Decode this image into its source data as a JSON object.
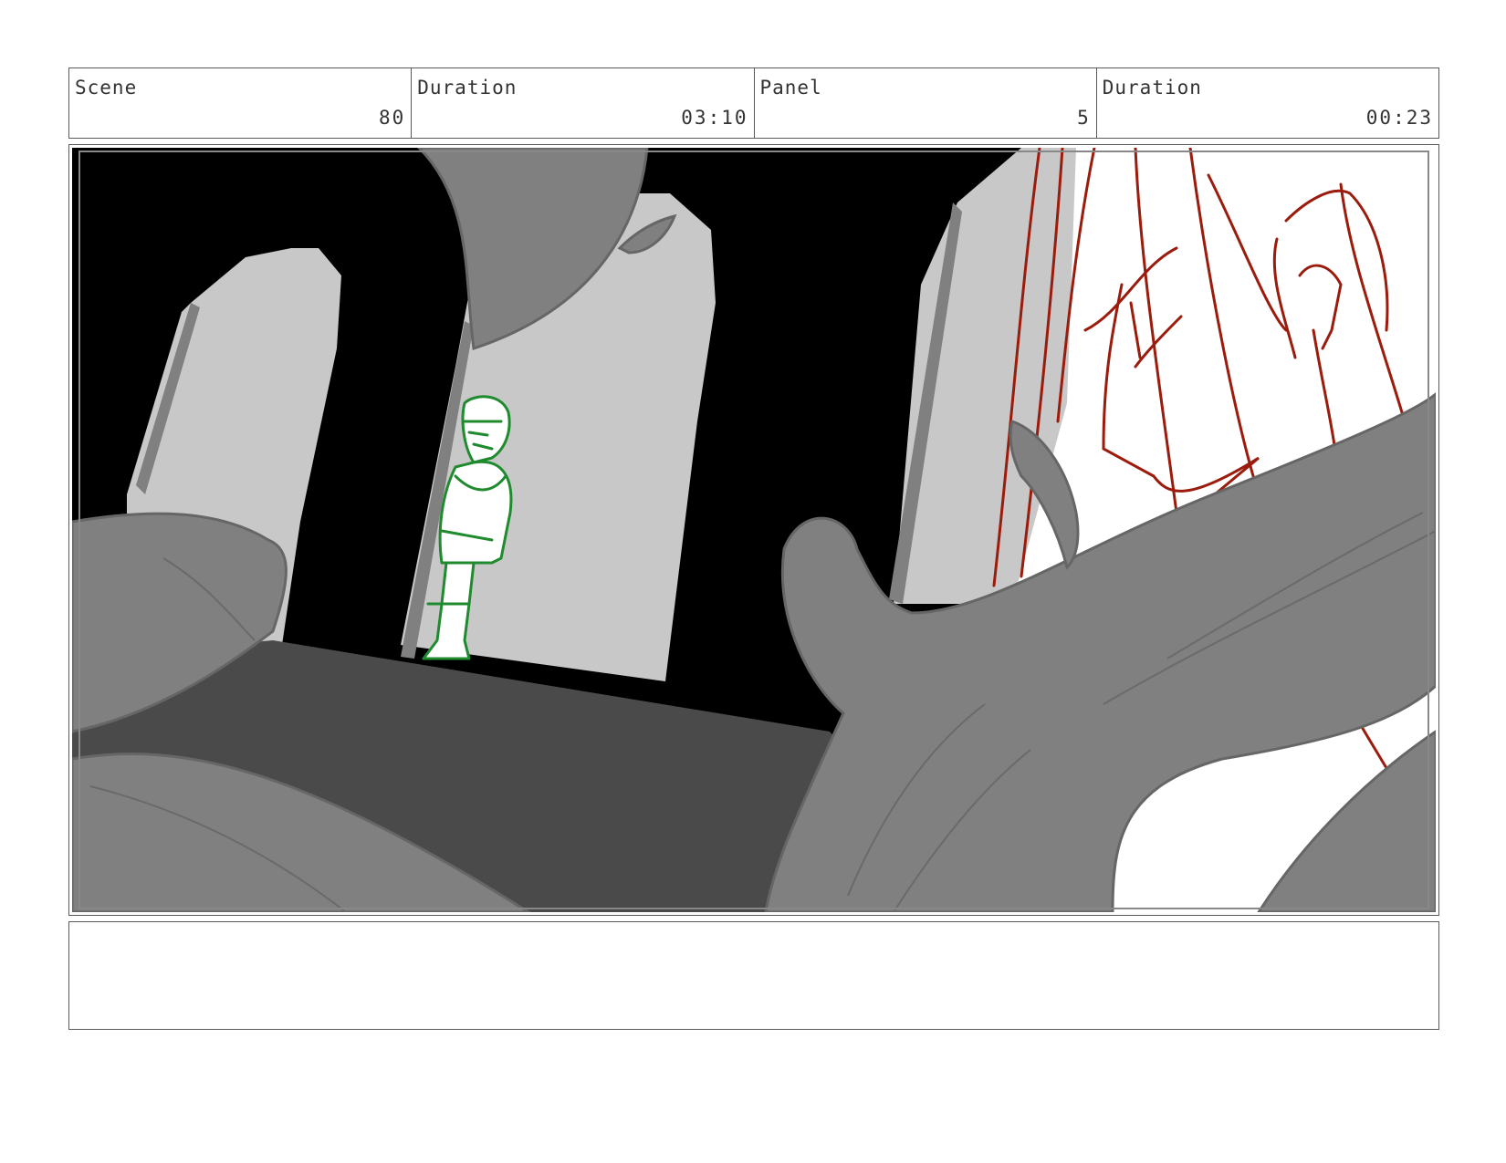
{
  "header": {
    "scene_label": "Scene",
    "scene_value": "80",
    "scene_duration_label": "Duration",
    "scene_duration_value": "03:10",
    "panel_label": "Panel",
    "panel_value": "5",
    "panel_duration_label": "Duration",
    "panel_duration_value": "00:23"
  },
  "notes": {
    "text": ""
  },
  "colors": {
    "border": "#5a5a5a",
    "green_sketch": "#1f8a2e",
    "red_sketch": "#9b1c0c",
    "dark_gray": "#4a4a4a",
    "mid_gray": "#808080",
    "light_gray": "#c8c8c8"
  }
}
